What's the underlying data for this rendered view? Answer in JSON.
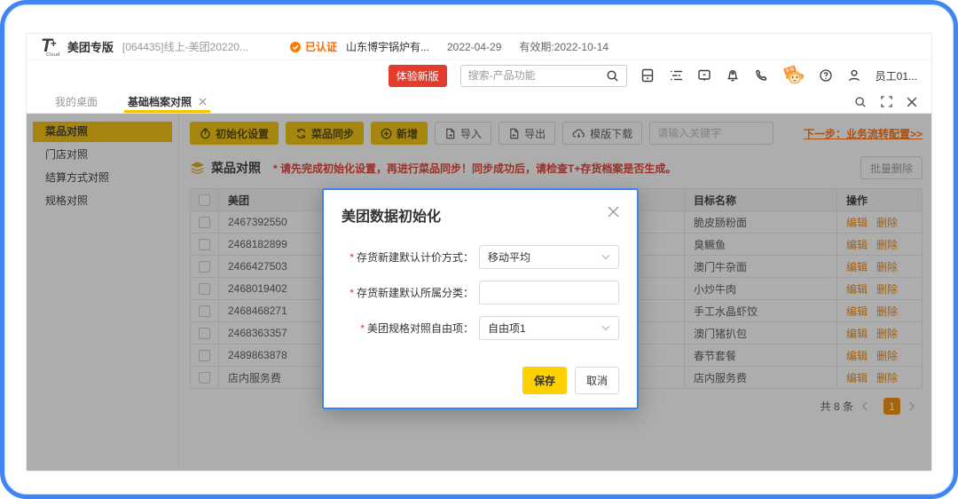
{
  "colors": {
    "frame_blue": "#3f86f4",
    "accent_yellow": "#f2c100",
    "save_yellow": "#fdd100",
    "brand_red": "#e23c2d",
    "link_orange": "#ff6a00",
    "action_orange": "#f08300",
    "notice_red": "#e03426",
    "modal_border_blue": "#3a85e8",
    "pagination_orange": "#ef8c00"
  },
  "topbar": {
    "logo_t": "T",
    "logo_plus": "+",
    "logo_cloud": "Cloud",
    "product": "美团专版",
    "account": "[064435]线上-美团20220...",
    "certified": "已认证",
    "company": "山东博宇锅炉有...",
    "date": "2022-04-29",
    "validity": "有效期:2022-10-14"
  },
  "header": {
    "try_new": "体验新版",
    "search_placeholder": "搜索-产品功能",
    "mascot_tag": "客服",
    "user": "员工01..."
  },
  "tabs": [
    {
      "label": "我的桌面",
      "active": false
    },
    {
      "label": "基础档案对照",
      "active": true
    }
  ],
  "sidebar": {
    "items": [
      {
        "label": "菜品对照",
        "active": true
      },
      {
        "label": "门店对照",
        "active": false
      },
      {
        "label": "结算方式对照",
        "active": false
      },
      {
        "label": "规格对照",
        "active": false
      }
    ]
  },
  "toolbar": {
    "init_settings": "初始化设置",
    "dish_sync": "菜品同步",
    "add": "新增",
    "import": "导入",
    "export": "导出",
    "template_download": "模版下载",
    "keyword_placeholder": "请输入关键字",
    "next_step": "下一步：业务流转配置>>"
  },
  "section": {
    "title": "菜品对照",
    "notice": "* 请先完成初始化设置，再进行菜品同步！同步成功后，请检查T+存货档案是否生成。",
    "batch_delete": "批量删除"
  },
  "table": {
    "columns": [
      "美团",
      "目标名称",
      "操作"
    ],
    "edit": "编辑",
    "delete": "删除",
    "rows": [
      {
        "meituan": "2467392550",
        "target": "脆皮肠粉面"
      },
      {
        "meituan": "2468182899",
        "target": "臭鳜鱼"
      },
      {
        "meituan": "2466427503",
        "target": "澳门牛杂面"
      },
      {
        "meituan": "2468019402",
        "target": "小炒牛肉"
      },
      {
        "meituan": "2468468271",
        "target": "手工水晶虾饺"
      },
      {
        "meituan": "2468363357",
        "target": "澳门猪扒包"
      },
      {
        "meituan": "2489863878",
        "target": "春节套餐"
      },
      {
        "meituan": "店内服务费",
        "target": "店内服务费"
      }
    ]
  },
  "pagination": {
    "total": "共 8 条",
    "page": "1"
  },
  "modal": {
    "title": "美团数据初始化",
    "required_mark": "*",
    "fields": {
      "pricing": {
        "label": "存货新建默认计价方式：",
        "value": "移动平均"
      },
      "category": {
        "label": "存货新建默认所属分类：",
        "value": ""
      },
      "free_item": {
        "label": "美团规格对照自由项：",
        "value": "自由项1"
      }
    },
    "save": "保存",
    "cancel": "取消"
  }
}
